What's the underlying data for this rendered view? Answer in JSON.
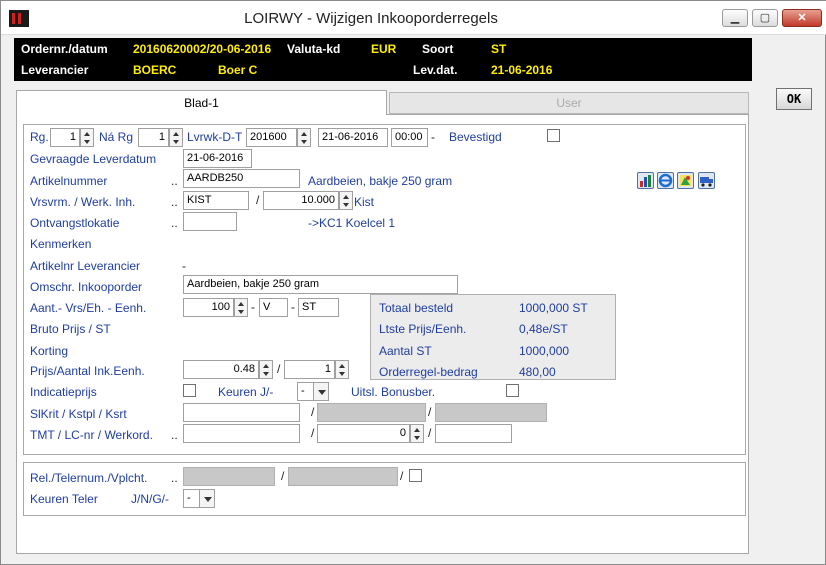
{
  "window": {
    "title": "LOIRWY - Wijzigen Inkooporderregels",
    "min_symbol": "▁",
    "max_symbol": "▢",
    "close_symbol": "✕"
  },
  "header": {
    "ordernr_label": "Ordernr./datum",
    "ordernr_value": "20160620002/20-06-2016",
    "valuta_label": "Valuta-kd",
    "valuta_value": "EUR",
    "soort_label": "Soort",
    "soort_value": "ST",
    "leverancier_label": "Leverancier",
    "leverancier_code": "BOERC",
    "leverancier_name": "Boer C",
    "levdat_label": "Lev.dat.",
    "levdat_value": "21-06-2016"
  },
  "ok_button": "OK",
  "tabs": [
    {
      "label": "Blad-1"
    },
    {
      "label": "User"
    }
  ],
  "form": {
    "rg_label": "Rg.",
    "rg_value": "1",
    "na_rg_label": "Ná Rg",
    "na_rg_value": "1",
    "lvrwk_label": "Lvrwk-D-T",
    "lvrwk_value": "201600",
    "lvrwk_date": "21-06-2016",
    "lvrwk_time": "00:00",
    "lvrwk_dash": "-",
    "bevestigd_label": "Bevestigd",
    "gevraagde_label": "Gevraagde Leverdatum",
    "gevraagde_value": "21-06-2016",
    "artikelnummer_label": "Artikelnummer",
    "artikelnummer_dots": "..",
    "artikelnummer_value": "AARDB250",
    "artikel_desc": "Aardbeien, bakje 250 gram",
    "vrsvrm_label": "Vrsvrm. / Werk. Inh.",
    "vrsvrm_dots": "..",
    "vrsvrm_value": "KIST",
    "vrsvrm_slash": "/",
    "werk_inh_value": "10.000",
    "werk_inh_unit": "Kist",
    "ontvangst_label": "Ontvangstlokatie",
    "ontvangst_dots": "..",
    "ontvangst_value": "",
    "ontvangst_desc": "->KC1 Koelcel 1",
    "kenmerken_label": "Kenmerken",
    "artikelnr_lev_label": "Artikelnr Leverancier",
    "artikelnr_lev_value": "-",
    "omschr_label": "Omschr. Inkooporder",
    "omschr_value": "Aardbeien, bakje 250 gram",
    "aant_label": "Aant.- Vrs/Eh. - Eenh.",
    "aant_value": "100",
    "aant_dash1": "-",
    "aant_vrs": "V",
    "aant_dash2": "-",
    "aant_eenh": "ST",
    "bruto_label": "Bruto Prijs / ST",
    "korting_label": "Korting",
    "prijs_label": "Prijs/Aantal Ink.Eenh.",
    "prijs_value": "0.48",
    "prijs_slash": "/",
    "prijs_aantal": "1",
    "indicatie_label": "Indicatieprijs",
    "keuren_label": "Keuren J/-",
    "keuren_value": "-",
    "uitsl_label": "Uitsl. Bonusber.",
    "slkrit_label": "SlKrit / Kstpl / Ksrt",
    "slkrit_slash1": "/",
    "slkrit_slash2": "/",
    "tmt_label": "TMT / LC-nr / Werkord.",
    "tmt_dots": "..",
    "tmt_lcnr": "0",
    "tmt_slash1": "/",
    "tmt_slash2": "/"
  },
  "totals": {
    "totaal_label": "Totaal besteld",
    "totaal_value": "1000,000 ST",
    "ltste_label": "Ltste Prijs/Eenh.",
    "ltste_value": "0,48e/ST",
    "aantal_label": "Aantal ST",
    "aantal_value": "1000,000",
    "bedrag_label": "Orderregel-bedrag",
    "bedrag_value": "480,00"
  },
  "lower": {
    "rel_label": "Rel./Telernum./Vplcht.",
    "rel_dots": "..",
    "rel_slash1": "/",
    "rel_slash2": "/",
    "keuren_teler_label": "Keuren Teler",
    "keuren_teler_options": "J/N/G/-",
    "keuren_teler_value": "-"
  },
  "colors": {
    "label_blue": "#1f3da1",
    "header_yellow": "#ffee00",
    "header_bg": "#000000"
  },
  "toolbar_icons": [
    "chart-icon",
    "internet-explorer-icon",
    "image-editor-icon",
    "truck-icon"
  ]
}
